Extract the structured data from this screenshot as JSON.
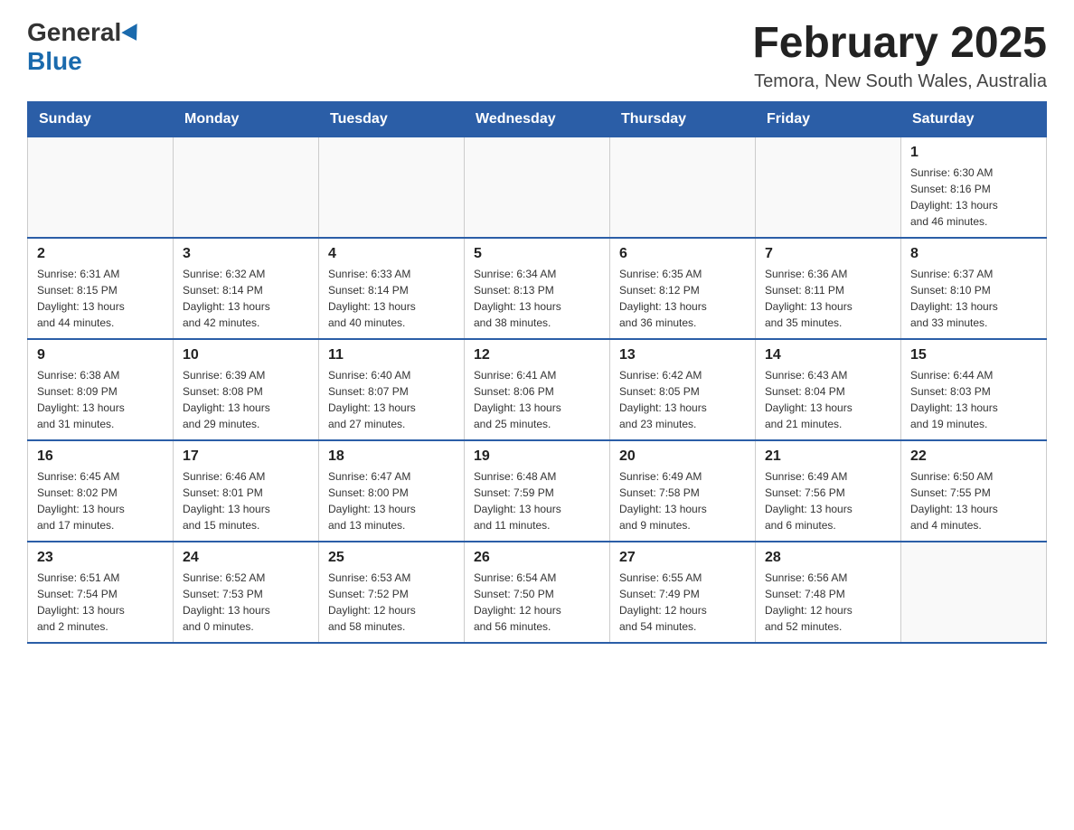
{
  "header": {
    "logo": {
      "general": "General",
      "blue": "Blue"
    },
    "title": "February 2025",
    "location": "Temora, New South Wales, Australia"
  },
  "weekdays": [
    "Sunday",
    "Monday",
    "Tuesday",
    "Wednesday",
    "Thursday",
    "Friday",
    "Saturday"
  ],
  "weeks": [
    {
      "days": [
        {
          "num": "",
          "info": "",
          "empty": true
        },
        {
          "num": "",
          "info": "",
          "empty": true
        },
        {
          "num": "",
          "info": "",
          "empty": true
        },
        {
          "num": "",
          "info": "",
          "empty": true
        },
        {
          "num": "",
          "info": "",
          "empty": true
        },
        {
          "num": "",
          "info": "",
          "empty": true
        },
        {
          "num": "1",
          "info": "Sunrise: 6:30 AM\nSunset: 8:16 PM\nDaylight: 13 hours\nand 46 minutes.",
          "empty": false
        }
      ]
    },
    {
      "days": [
        {
          "num": "2",
          "info": "Sunrise: 6:31 AM\nSunset: 8:15 PM\nDaylight: 13 hours\nand 44 minutes.",
          "empty": false
        },
        {
          "num": "3",
          "info": "Sunrise: 6:32 AM\nSunset: 8:14 PM\nDaylight: 13 hours\nand 42 minutes.",
          "empty": false
        },
        {
          "num": "4",
          "info": "Sunrise: 6:33 AM\nSunset: 8:14 PM\nDaylight: 13 hours\nand 40 minutes.",
          "empty": false
        },
        {
          "num": "5",
          "info": "Sunrise: 6:34 AM\nSunset: 8:13 PM\nDaylight: 13 hours\nand 38 minutes.",
          "empty": false
        },
        {
          "num": "6",
          "info": "Sunrise: 6:35 AM\nSunset: 8:12 PM\nDaylight: 13 hours\nand 36 minutes.",
          "empty": false
        },
        {
          "num": "7",
          "info": "Sunrise: 6:36 AM\nSunset: 8:11 PM\nDaylight: 13 hours\nand 35 minutes.",
          "empty": false
        },
        {
          "num": "8",
          "info": "Sunrise: 6:37 AM\nSunset: 8:10 PM\nDaylight: 13 hours\nand 33 minutes.",
          "empty": false
        }
      ]
    },
    {
      "days": [
        {
          "num": "9",
          "info": "Sunrise: 6:38 AM\nSunset: 8:09 PM\nDaylight: 13 hours\nand 31 minutes.",
          "empty": false
        },
        {
          "num": "10",
          "info": "Sunrise: 6:39 AM\nSunset: 8:08 PM\nDaylight: 13 hours\nand 29 minutes.",
          "empty": false
        },
        {
          "num": "11",
          "info": "Sunrise: 6:40 AM\nSunset: 8:07 PM\nDaylight: 13 hours\nand 27 minutes.",
          "empty": false
        },
        {
          "num": "12",
          "info": "Sunrise: 6:41 AM\nSunset: 8:06 PM\nDaylight: 13 hours\nand 25 minutes.",
          "empty": false
        },
        {
          "num": "13",
          "info": "Sunrise: 6:42 AM\nSunset: 8:05 PM\nDaylight: 13 hours\nand 23 minutes.",
          "empty": false
        },
        {
          "num": "14",
          "info": "Sunrise: 6:43 AM\nSunset: 8:04 PM\nDaylight: 13 hours\nand 21 minutes.",
          "empty": false
        },
        {
          "num": "15",
          "info": "Sunrise: 6:44 AM\nSunset: 8:03 PM\nDaylight: 13 hours\nand 19 minutes.",
          "empty": false
        }
      ]
    },
    {
      "days": [
        {
          "num": "16",
          "info": "Sunrise: 6:45 AM\nSunset: 8:02 PM\nDaylight: 13 hours\nand 17 minutes.",
          "empty": false
        },
        {
          "num": "17",
          "info": "Sunrise: 6:46 AM\nSunset: 8:01 PM\nDaylight: 13 hours\nand 15 minutes.",
          "empty": false
        },
        {
          "num": "18",
          "info": "Sunrise: 6:47 AM\nSunset: 8:00 PM\nDaylight: 13 hours\nand 13 minutes.",
          "empty": false
        },
        {
          "num": "19",
          "info": "Sunrise: 6:48 AM\nSunset: 7:59 PM\nDaylight: 13 hours\nand 11 minutes.",
          "empty": false
        },
        {
          "num": "20",
          "info": "Sunrise: 6:49 AM\nSunset: 7:58 PM\nDaylight: 13 hours\nand 9 minutes.",
          "empty": false
        },
        {
          "num": "21",
          "info": "Sunrise: 6:49 AM\nSunset: 7:56 PM\nDaylight: 13 hours\nand 6 minutes.",
          "empty": false
        },
        {
          "num": "22",
          "info": "Sunrise: 6:50 AM\nSunset: 7:55 PM\nDaylight: 13 hours\nand 4 minutes.",
          "empty": false
        }
      ]
    },
    {
      "days": [
        {
          "num": "23",
          "info": "Sunrise: 6:51 AM\nSunset: 7:54 PM\nDaylight: 13 hours\nand 2 minutes.",
          "empty": false
        },
        {
          "num": "24",
          "info": "Sunrise: 6:52 AM\nSunset: 7:53 PM\nDaylight: 13 hours\nand 0 minutes.",
          "empty": false
        },
        {
          "num": "25",
          "info": "Sunrise: 6:53 AM\nSunset: 7:52 PM\nDaylight: 12 hours\nand 58 minutes.",
          "empty": false
        },
        {
          "num": "26",
          "info": "Sunrise: 6:54 AM\nSunset: 7:50 PM\nDaylight: 12 hours\nand 56 minutes.",
          "empty": false
        },
        {
          "num": "27",
          "info": "Sunrise: 6:55 AM\nSunset: 7:49 PM\nDaylight: 12 hours\nand 54 minutes.",
          "empty": false
        },
        {
          "num": "28",
          "info": "Sunrise: 6:56 AM\nSunset: 7:48 PM\nDaylight: 12 hours\nand 52 minutes.",
          "empty": false
        },
        {
          "num": "",
          "info": "",
          "empty": true
        }
      ]
    }
  ]
}
